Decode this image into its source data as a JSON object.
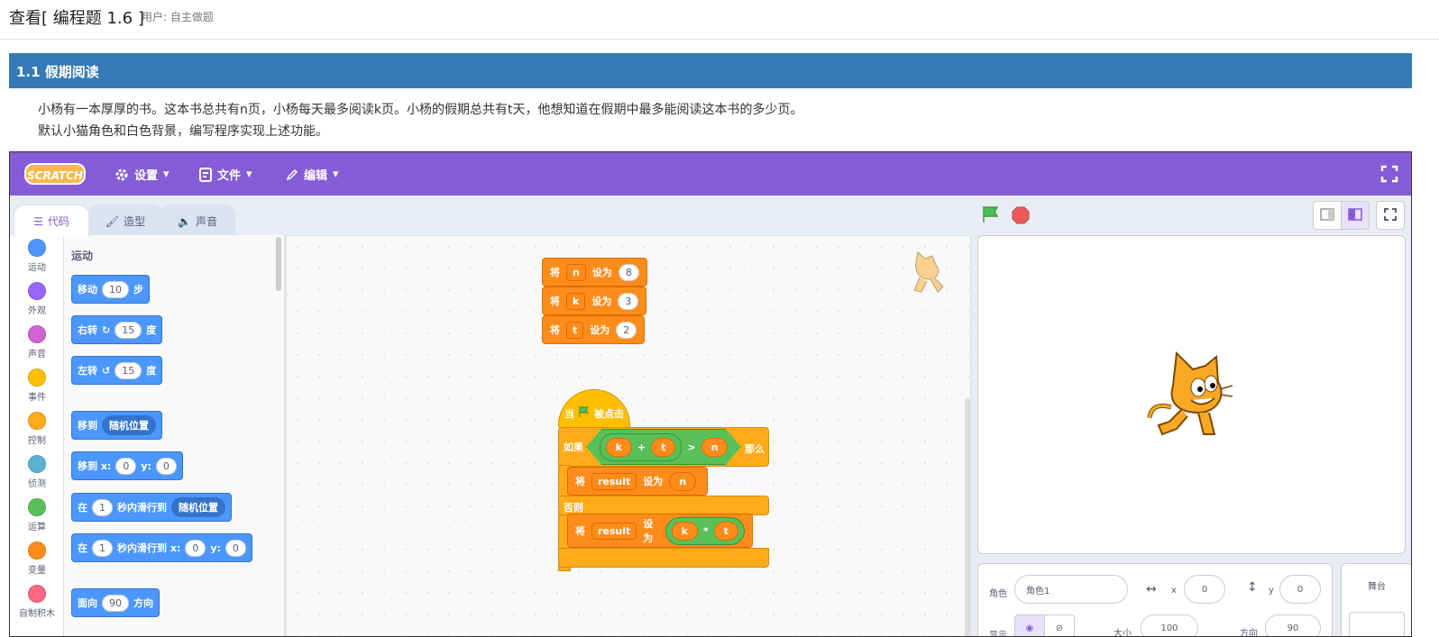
{
  "page": {
    "title": "查看[ 编程题 1.6 ]",
    "user": "用户: 自主做题"
  },
  "section": {
    "title": "1.1 假期阅读"
  },
  "problem": {
    "line1": "小杨有一本厚厚的书。这本书总共有n页，小杨每天最多阅读k页。小杨的假期总共有t天，他想知道在假期中最多能阅读这本书的多少页。",
    "line2": "默认小猫角色和白色背景，编写程序实现上述功能。"
  },
  "scratch": {
    "logo": "SCRATCH",
    "menu": {
      "settings": "设置",
      "file": "文件",
      "edit": "编辑"
    },
    "tabs": {
      "code": "代码",
      "costumes": "造型",
      "sounds": "声音"
    },
    "categories": [
      {
        "label": "运动",
        "color": "#4c97ff"
      },
      {
        "label": "外观",
        "color": "#9966ff"
      },
      {
        "label": "声音",
        "color": "#cf63cf"
      },
      {
        "label": "事件",
        "color": "#ffbf00"
      },
      {
        "label": "控制",
        "color": "#ffab19"
      },
      {
        "label": "侦测",
        "color": "#5cb1d6"
      },
      {
        "label": "运算",
        "color": "#59c059"
      },
      {
        "label": "变量",
        "color": "#ff8c1a"
      },
      {
        "label": "自制积木",
        "color": "#ff6680"
      }
    ],
    "flyout": {
      "heading": "运动",
      "move": {
        "a": "移动",
        "v": "10",
        "b": "步"
      },
      "turn_right": {
        "a": "右转",
        "v": "15",
        "b": "度"
      },
      "turn_left": {
        "a": "左转",
        "v": "15",
        "b": "度"
      },
      "goto": {
        "a": "移到",
        "dd": "随机位置"
      },
      "goto_xy": {
        "a": "移到 x:",
        "x": "0",
        "ylab": "y:",
        "y": "0"
      },
      "glide": {
        "a": "在",
        "v": "1",
        "b": "秒内滑行到",
        "dd": "随机位置"
      },
      "glide_xy": {
        "a": "在",
        "v": "1",
        "b": "秒内滑行到 x:",
        "x": "0",
        "ylab": "y:",
        "y": "0"
      },
      "point": {
        "a": "面向",
        "v": "90",
        "b": "方向"
      }
    },
    "script1": [
      {
        "kw": "将",
        "var": "n",
        "set": "设为",
        "val": "8"
      },
      {
        "kw": "将",
        "var": "k",
        "set": "设为",
        "val": "3"
      },
      {
        "kw": "将",
        "var": "t",
        "set": "设为",
        "val": "2"
      }
    ],
    "script2": {
      "hat_a": "当",
      "hat_b": "被点击",
      "if": "如果",
      "then": "那么",
      "else": "否则",
      "cond": {
        "a": "k",
        "op1": "+",
        "b": "t",
        "op2": ">",
        "c": "n"
      },
      "set1": {
        "kw": "将",
        "var": "result",
        "set": "设为",
        "val": "n"
      },
      "set2": {
        "kw": "将",
        "var": "result",
        "set": "设为",
        "a": "k",
        "op": "*",
        "b": "t"
      }
    },
    "sprite_panel": {
      "sprite_label": "角色",
      "sprite_name": "角色1",
      "x_label": "x",
      "x": "0",
      "y_label": "y",
      "y": "0",
      "show_label": "显示",
      "size_label": "大小",
      "size": "100",
      "dir_label": "方向",
      "dir": "90"
    },
    "stage_label": "舞台"
  }
}
